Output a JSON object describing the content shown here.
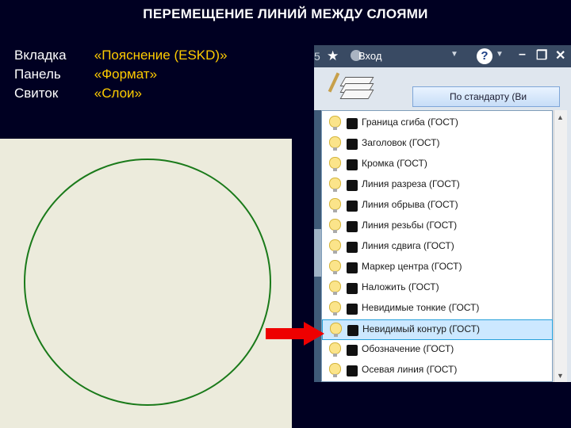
{
  "slide_title": "ПЕРЕМЕЩЕНИЕ ЛИНИЙ МЕЖДУ СЛОЯМИ",
  "instructions": [
    {
      "label": "Вкладка",
      "value": "«Пояснение (ESKD)»"
    },
    {
      "label": "Панель",
      "value": "«Формат»"
    },
    {
      "label": "Свиток",
      "value": "«Слои»"
    }
  ],
  "app": {
    "titlebar": {
      "left_glyph": "5",
      "login_label": "Вход",
      "help_label": "?"
    },
    "standard_box": "По стандарту (Ви",
    "layers": [
      "Граница сгиба (ГОСТ)",
      "Заголовок (ГОСТ)",
      "Кромка (ГОСТ)",
      "Линия  разреза (ГОСТ)",
      "Линия обрыва (ГОСТ)",
      "Линия резьбы (ГОСТ)",
      "Линия сдвига (ГОСТ)",
      "Маркер центра (ГОСТ)",
      "Наложить (ГОСТ)",
      "Невидимые тонкие (ГОСТ)",
      "Невидимый контур (ГОСТ)",
      "Обозначение (ГОСТ)",
      "Осевая линия (ГОСТ)"
    ],
    "selected_layer": "Невидимый контур (ГОСТ)"
  },
  "icons": [
    "star-icon",
    "user-icon",
    "help-icon",
    "minimize-icon",
    "restore-icon",
    "close-icon",
    "layers-icon",
    "lightbulb-icon",
    "color-swatch-icon",
    "scroll-up-icon",
    "scroll-down-icon",
    "red-arrow-icon"
  ],
  "colors": {
    "slide_bg": "#000022",
    "highlight": "#ffcc00",
    "drawing_bg": "#ecebdc",
    "circle": "#1a7a1a",
    "arrow": "#ee0000",
    "selection": "#cce8ff"
  }
}
